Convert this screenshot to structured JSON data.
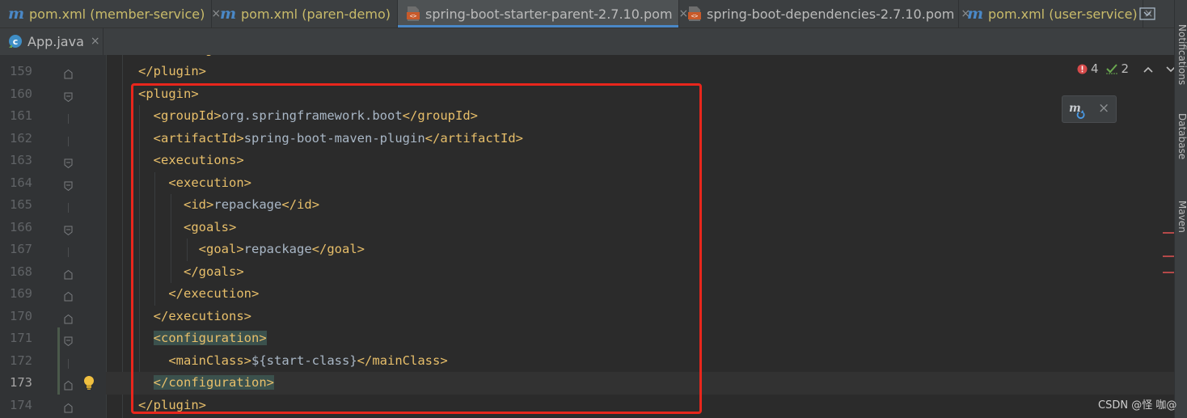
{
  "tabs": [
    {
      "label": "pom.xml (member-service)",
      "icon": "maven-icon",
      "active": false
    },
    {
      "label": "pom.xml (paren-demo)",
      "icon": "maven-icon",
      "active": false
    },
    {
      "label": "spring-boot-starter-parent-2.7.10.pom",
      "icon": "xml-file-icon",
      "active": true
    },
    {
      "label": "spring-boot-dependencies-2.7.10.pom",
      "icon": "xml-file-icon",
      "active": false
    },
    {
      "label": "pom.xml (user-service)",
      "icon": "maven-icon",
      "active": false
    }
  ],
  "tabs_row2": [
    {
      "label": "App.java",
      "icon": "java-class-icon",
      "active": false
    }
  ],
  "close_glyph": "×",
  "editor": {
    "first_partial_line": "    </configuration>",
    "current_line": 173,
    "lines": [
      {
        "num": "159",
        "code": "</plugin>"
      },
      {
        "num": "160",
        "code": "<plugin>"
      },
      {
        "num": "161",
        "code": "  <groupId>org.springframework.boot</groupId>"
      },
      {
        "num": "162",
        "code": "  <artifactId>spring-boot-maven-plugin</artifactId>"
      },
      {
        "num": "163",
        "code": "  <executions>"
      },
      {
        "num": "164",
        "code": "    <execution>"
      },
      {
        "num": "165",
        "code": "      <id>repackage</id>"
      },
      {
        "num": "166",
        "code": "      <goals>"
      },
      {
        "num": "167",
        "code": "        <goal>repackage</goal>"
      },
      {
        "num": "168",
        "code": "      </goals>"
      },
      {
        "num": "169",
        "code": "    </execution>"
      },
      {
        "num": "170",
        "code": "  </executions>"
      },
      {
        "num": "171",
        "code": "  <configuration>"
      },
      {
        "num": "172",
        "code": "    <mainClass>${start-class}</mainClass>"
      },
      {
        "num": "173",
        "code": "  </configuration>"
      },
      {
        "num": "174",
        "code": "</plugin>"
      }
    ]
  },
  "inspections": {
    "errors": "4",
    "warnings": "2"
  },
  "right_sidebar": [
    "Notifications",
    "Database",
    "Maven"
  ],
  "watermark": "CSDN @怪 咖@",
  "colors": {
    "tag": "#e8bf6a",
    "text": "#a9b7c6",
    "highlight_box": "#e8261c",
    "active_tab_underline": "#4a88c7",
    "matched_tag_bg": "#3b514d"
  }
}
